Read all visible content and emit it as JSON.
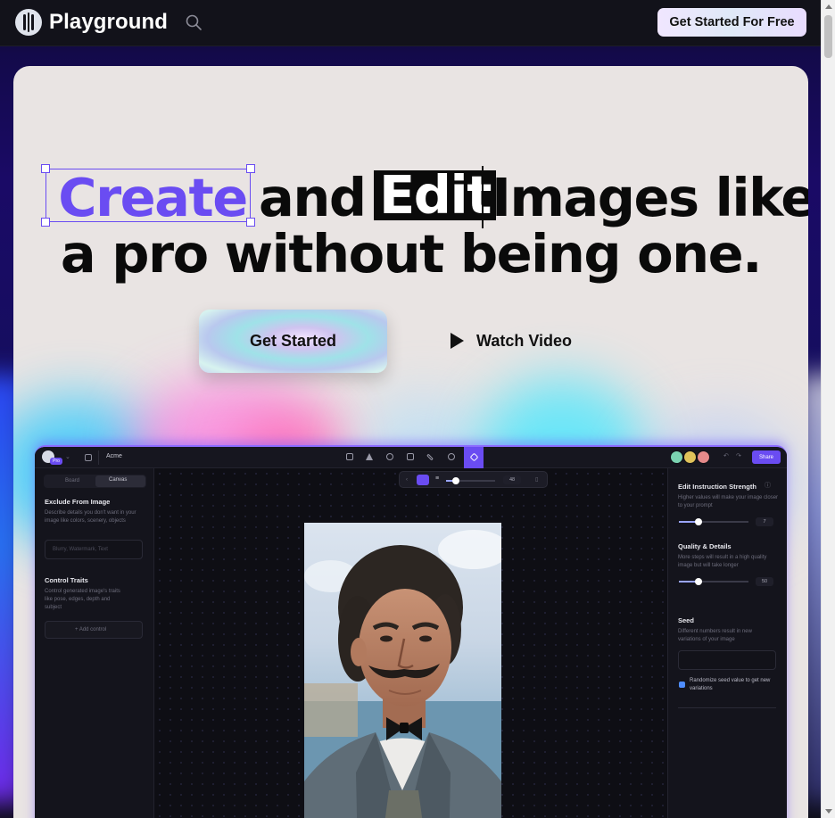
{
  "header": {
    "brand": "Playground",
    "cta_label": "Get Started For Free"
  },
  "hero": {
    "word_create": "Create",
    "word_and": "and",
    "word_edit": "Edit",
    "word_rest": "Images like",
    "line2": "a pro without being one.",
    "primary_button": "Get Started",
    "secondary_button": "Watch Video"
  },
  "app": {
    "project_name": "Acme",
    "badge": "Pro",
    "share": "Share",
    "tabs": [
      "Board",
      "Canvas"
    ],
    "active_tab": "Canvas",
    "zoom_value": "48",
    "left": {
      "exclude_title": "Exclude From Image",
      "exclude_desc": "Describe details you don't want in your image like colors, scenery, objects",
      "exclude_placeholder": "Blurry, Watermark, Text",
      "control_title": "Control Traits",
      "control_desc": "Control generated image's traits like pose, edges, depth and subject",
      "add_control": "+ Add control"
    },
    "right": {
      "strength_title": "Edit Instruction Strength",
      "strength_desc": "Higher values will make your image closer to your prompt",
      "strength_value": "7",
      "strength_level": 0.28,
      "quality_title": "Quality & Details",
      "quality_desc": "More steps will result in a high quality image but will take longer",
      "quality_value": "50",
      "quality_level": 0.28,
      "seed_title": "Seed",
      "seed_desc": "Different numbers result in new variations of your image",
      "randomize_label": "Randomize seed value to get new variations",
      "randomize_checked": true
    }
  },
  "colors": {
    "accent": "#6a4cf2",
    "hero_bg": "#e9e4e3",
    "header_bg": "#12121a"
  },
  "icons": [
    "brand-logo-icon",
    "search-icon",
    "play-icon"
  ]
}
